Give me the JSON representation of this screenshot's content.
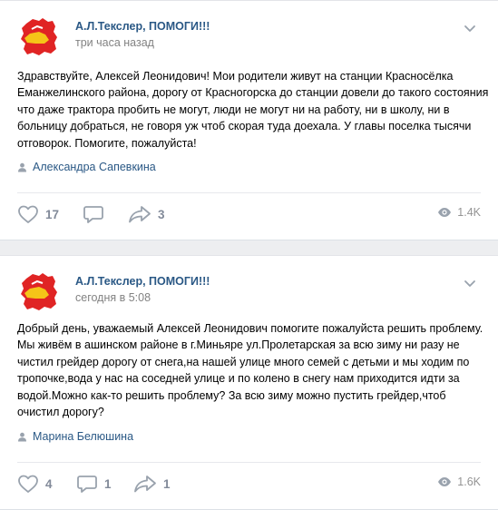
{
  "posts": [
    {
      "author": "А.Л.Текслер, ПОМОГИ!!!",
      "time": "три часа назад",
      "text": "Здравствуйте, Алексей Леонидович! Мои родители живут на станции Красносёлка Еманжелинского района, дорогу от Красногорска до станции довели до такого состояния что даже трактора пробить не могут, люди не могут ни на работу, ни в школу, ни в больницу добраться, не говоря уж чтоб скорая туда доехала. У главы поселка тысячи отговорок. Помогите, пожалуйста!",
      "signer": "Александра Сапевкина",
      "likes": "17",
      "comments": "",
      "shares": "3",
      "views": "1.4K"
    },
    {
      "author": "А.Л.Текслер, ПОМОГИ!!!",
      "time": "сегодня в 5:08",
      "text": "Добрый день, уважаемый Алексей Леонидович помогите пожалуйста решить проблему. Мы живём в ашинском районе в г.Миньяре ул.Пролетарская за всю зиму ни разу не чистил грейдер дорогу от снега,на нашей улице много семей с детьми и мы ходим по тропочке,вода у нас на соседней улице и по колено в снегу нам приходится идти за водой.Можно как-то решить проблему? За всю зиму можно пустить грейдер,чтоб очистил дорогу?",
      "signer": "Марина Белюшина",
      "likes": "4",
      "comments": "1",
      "shares": "1",
      "views": "1.6K"
    }
  ],
  "colors": {
    "link": "#2a5885",
    "muted": "#828282",
    "icon": "#99a2ad",
    "background": "#edeef0",
    "avatar_red": "#e02424",
    "avatar_yellow": "#f5c518"
  },
  "icons": [
    "community-avatar",
    "more-chevron-icon",
    "person-icon",
    "heart-icon",
    "comment-icon",
    "share-icon",
    "eye-icon"
  ]
}
